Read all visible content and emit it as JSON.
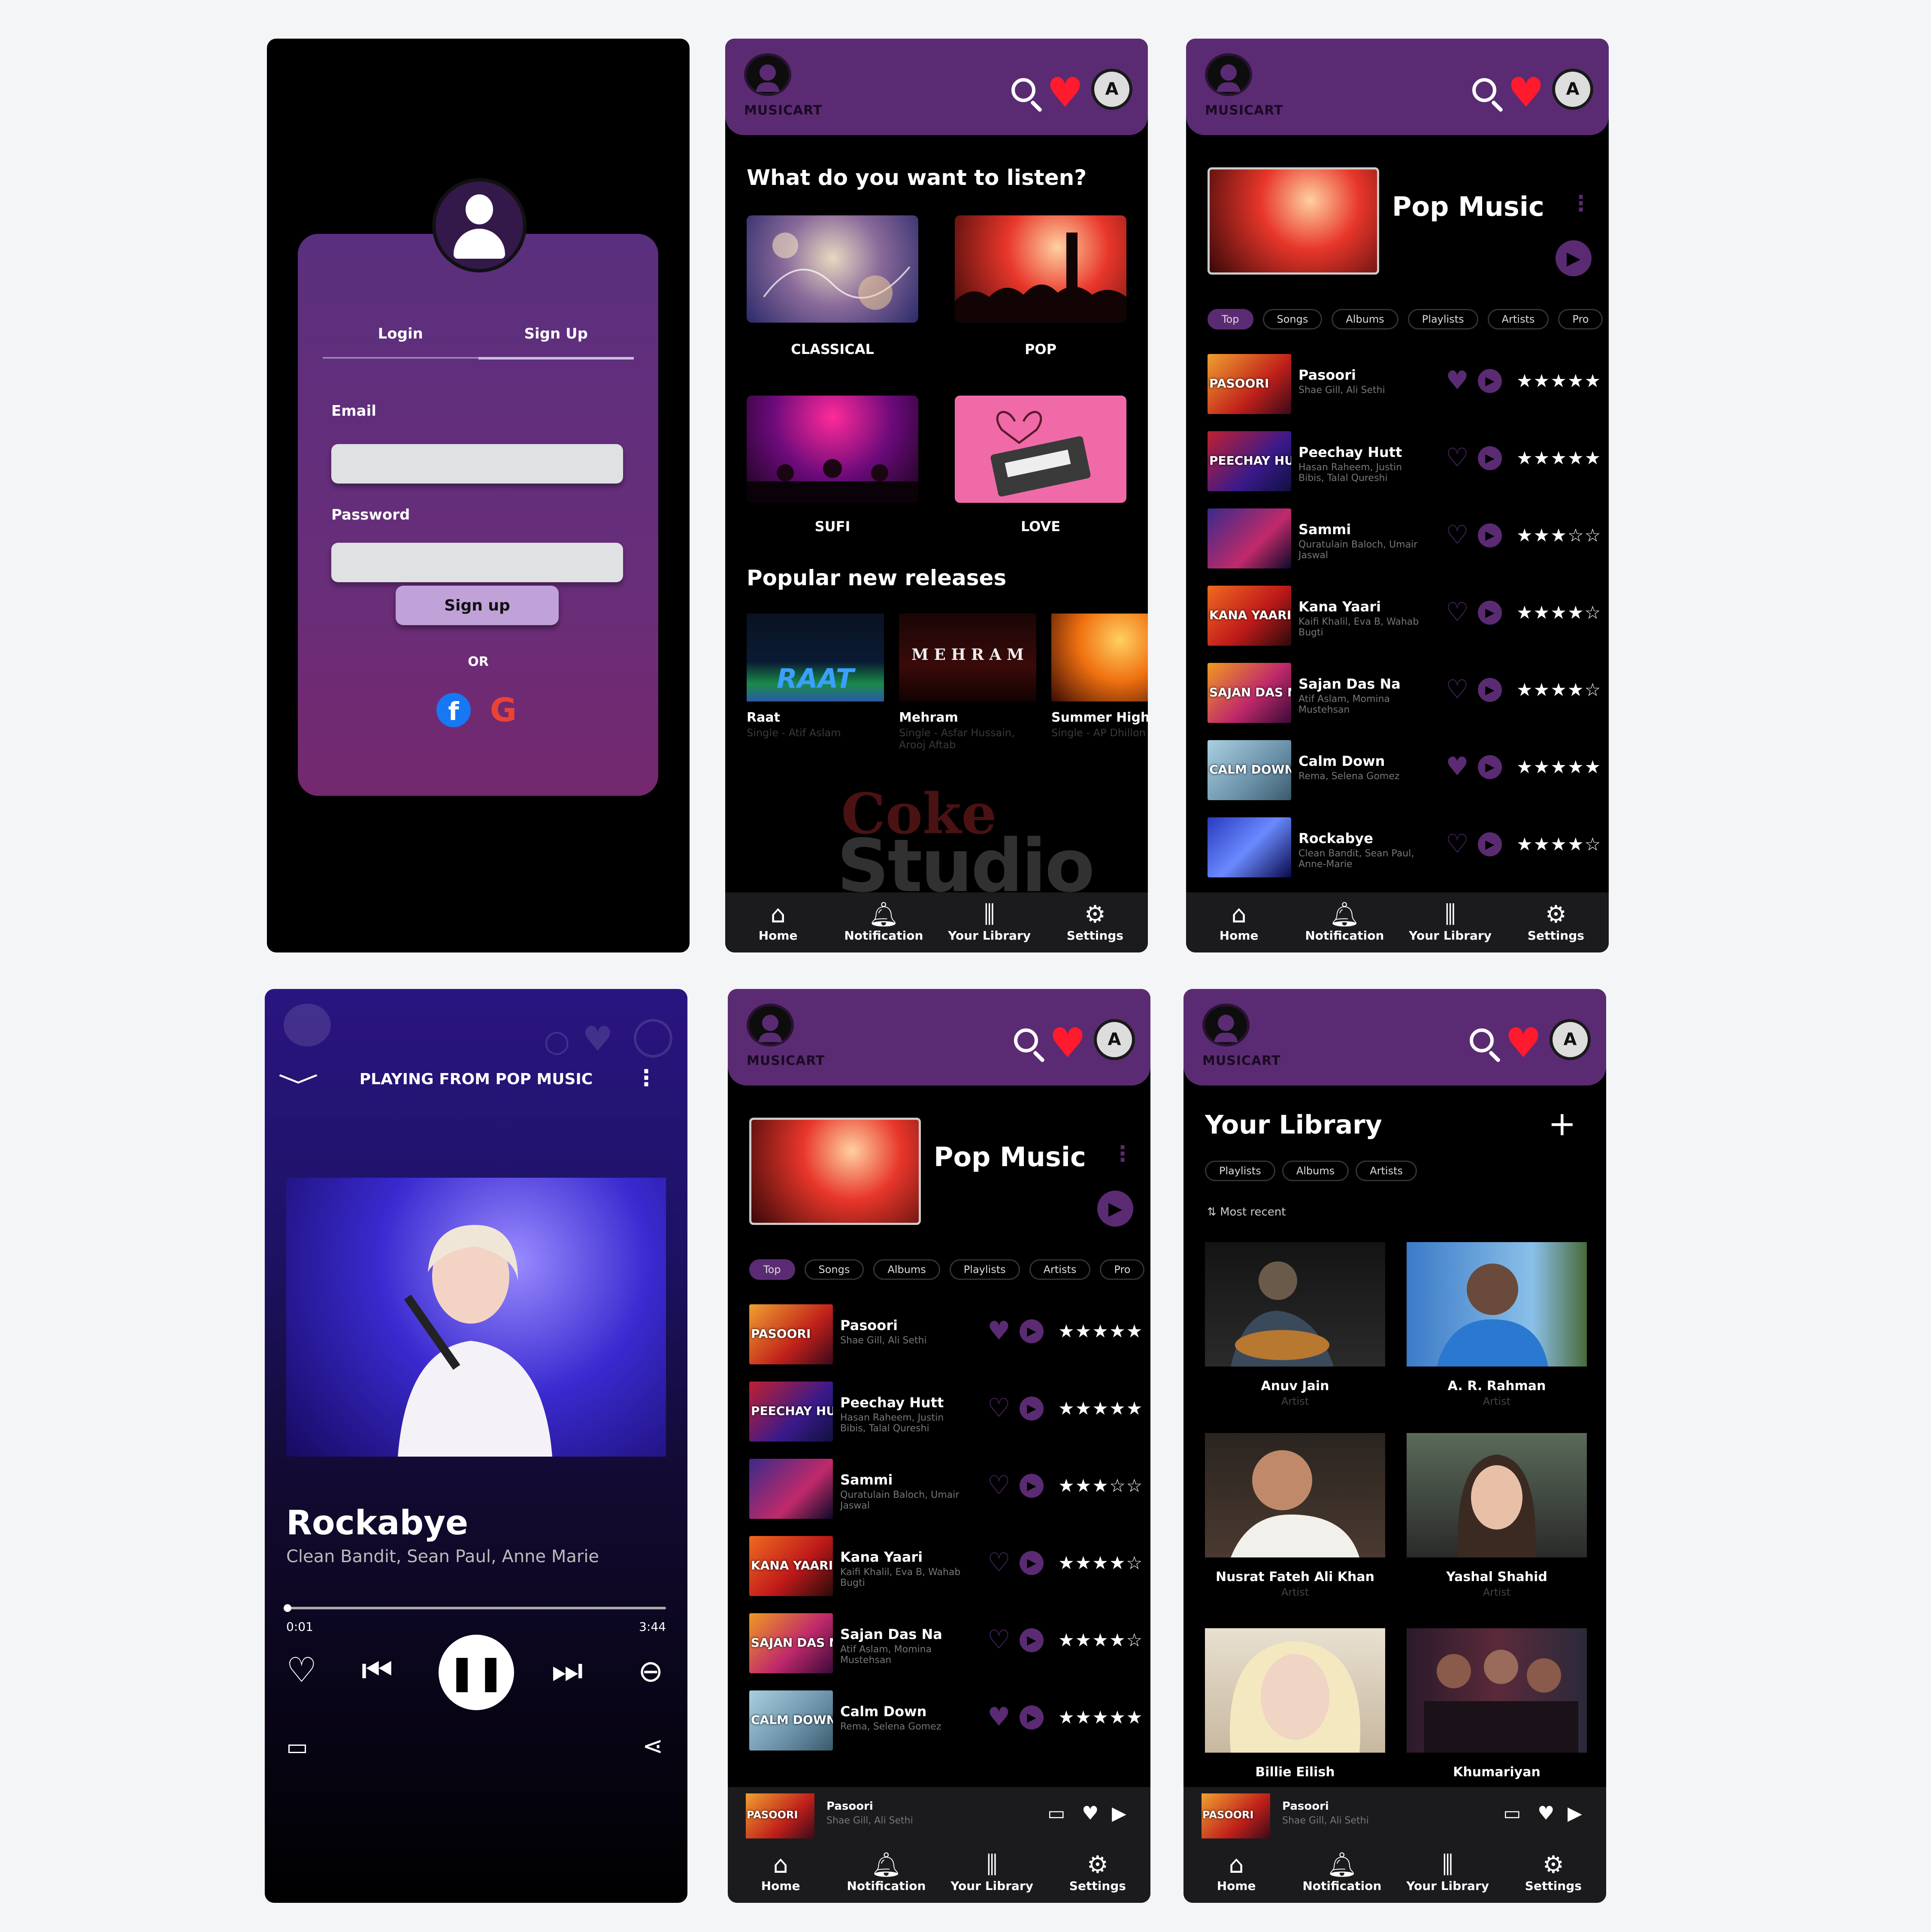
{
  "header": {
    "logo_text": "MUSICART",
    "avatar_letter": "A"
  },
  "nav": {
    "home": "Home",
    "notification": "Notification",
    "library": "Your Library",
    "settings": "Settings"
  },
  "login": {
    "tab_login": "Login",
    "tab_signup": "Sign Up",
    "email_label": "Email",
    "password_label": "Password",
    "button": "Sign up",
    "or": "OR",
    "facebook_glyph": "f",
    "google_glyph": "G"
  },
  "home": {
    "question": "What do you want to listen?",
    "genres": [
      "CLASSICAL",
      "POP",
      "SUFI",
      "LOVE"
    ],
    "popular_heading": "Popular new releases",
    "releases": [
      {
        "title": "Raat",
        "sub": "Single - Atif Aslam",
        "art_text": "RAAT"
      },
      {
        "title": "Mehram",
        "sub": "Single - Asfar Hussain, Arooj Aftab",
        "art_text": "M E H R A M"
      },
      {
        "title": "Summer High",
        "sub": "Single - AP Dhillon",
        "art_text": ""
      }
    ],
    "watermark_1": "Coke",
    "watermark_2": "Studio"
  },
  "playlist": {
    "title": "Pop Music",
    "chips": [
      "Top",
      "Songs",
      "Albums",
      "Playlists",
      "Artists",
      "Pro"
    ],
    "songs": [
      {
        "name": "Pasoori",
        "artist": "Shae Gill, Ali Sethi",
        "thumb": "PASOORI",
        "stars": "★★★★★",
        "liked": true
      },
      {
        "name": "Peechay Hutt",
        "artist": "Hasan Raheem, Justin Bibis, Talal Qureshi",
        "thumb": "PEECHAY HUTT",
        "stars": "★★★★★",
        "liked": false
      },
      {
        "name": "Sammi",
        "artist": "Quratulain Baloch, Umair Jaswal",
        "thumb": "",
        "stars": "★★★☆☆",
        "liked": false
      },
      {
        "name": "Kana Yaari",
        "artist": "Kaifi Khalil, Eva B, Wahab Bugti",
        "thumb": "KANA YAARI",
        "stars": "★★★★☆",
        "liked": false
      },
      {
        "name": "Sajan Das Na",
        "artist": "Atif Aslam, Momina Mustehsan",
        "thumb": "SAJAN DAS NA",
        "stars": "★★★★☆",
        "liked": false
      },
      {
        "name": "Calm Down",
        "artist": "Rema, Selena Gomez",
        "thumb": "CALM DOWN",
        "stars": "★★★★★",
        "liked": true
      },
      {
        "name": "Rockabye",
        "artist": "Clean Bandit, Sean Paul, Anne-Marie",
        "thumb": "",
        "stars": "★★★★☆",
        "liked": false
      }
    ]
  },
  "player": {
    "playing_from": "PLAYING FROM POP MUSIC",
    "title": "Rockabye",
    "artists": "Clean Bandit, Sean Paul, Anne Marie",
    "elapsed": "0:01",
    "duration": "3:44",
    "progress": 0.01
  },
  "mini_player": {
    "name": "Pasoori",
    "artist": "Shae Gill, Ali Sethi",
    "thumb": "PASOORI"
  },
  "library": {
    "title": "Your Library",
    "chips": [
      "Playlists",
      "Albums",
      "Artists"
    ],
    "sort": "Most recent",
    "artists": [
      {
        "name": "Anuv Jain",
        "type": "Artist"
      },
      {
        "name": "A. R. Rahman",
        "type": "Artist"
      },
      {
        "name": "Nusrat Fateh Ali Khan",
        "type": "Artist"
      },
      {
        "name": "Yashal Shahid",
        "type": "Artist"
      },
      {
        "name": "Billie Eilish",
        "type": ""
      },
      {
        "name": "Khumariyan",
        "type": ""
      }
    ]
  },
  "colors": {
    "brand": "#5a2b72",
    "heart": "#ff1a2e",
    "background": "#f4f5f6"
  }
}
